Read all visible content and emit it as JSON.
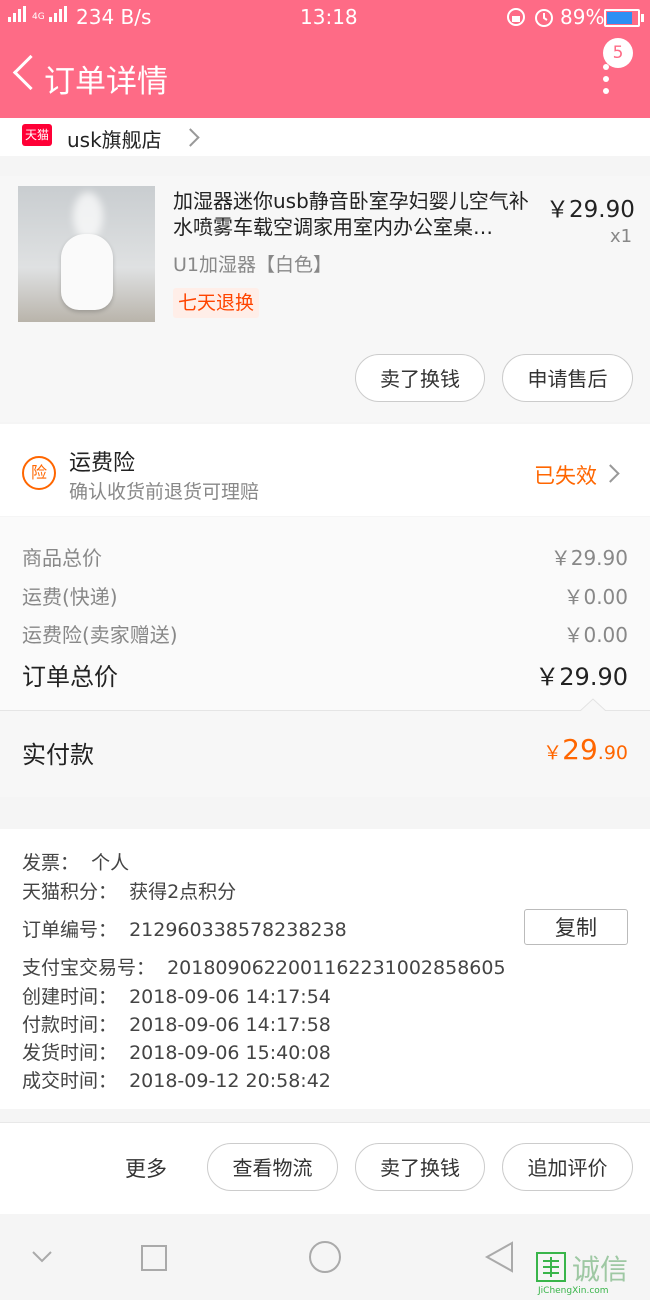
{
  "status_bar": {
    "network": "4G",
    "speed": "234 B/s",
    "time": "13:18",
    "battery": "89%",
    "battery_level": 0.89
  },
  "header": {
    "title": "订单详情",
    "badge_count": "5"
  },
  "shop": {
    "platform_icon": "天猫",
    "name": "usk旗舰店"
  },
  "product": {
    "name": "加湿器迷你usb静音卧室孕妇婴儿空气补水喷雾车载空调家用室内办公室桌…",
    "price": "￥29.90",
    "quantity": "x1",
    "sku": "U1加湿器【白色】",
    "tag": "七天退换",
    "buttons": [
      "卖了换钱",
      "申请售后"
    ]
  },
  "insurance": {
    "icon_label": "险",
    "title": "运费险",
    "subtitle": "确认收货前退货可理赔",
    "status": "已失效"
  },
  "price_summary": {
    "rows": [
      {
        "label": "商品总价",
        "value": "￥29.90"
      },
      {
        "label": "运费(快递)",
        "value": "￥0.00"
      },
      {
        "label": "运费险(卖家赠送)",
        "value": "￥0.00"
      }
    ],
    "total_label": "订单总价",
    "total_value": "￥29.90",
    "paid_label": "实付款",
    "paid_currency": "￥",
    "paid_integer": "29",
    "paid_decimal": ".90"
  },
  "order_info": {
    "invoice": "发票：  个人",
    "points": "天猫积分：  获得2点积分",
    "order_no": "订单编号：  212960338578238238",
    "copy_label": "复制",
    "alipay_no": "支付宝交易号：  2018090622001162231002858605",
    "created": "创建时间：  2018-09-06 14:17:54",
    "paid": "付款时间：  2018-09-06 14:17:58",
    "shipped": "发货时间：  2018-09-06 15:40:08",
    "completed": "成交时间：  2018-09-12 20:58:42"
  },
  "actions": {
    "more": "更多",
    "buttons": [
      "查看物流",
      "卖了换钱",
      "追加评价"
    ]
  },
  "watermark": {
    "text": "诚信",
    "url_text": "JiChengXin.com"
  }
}
